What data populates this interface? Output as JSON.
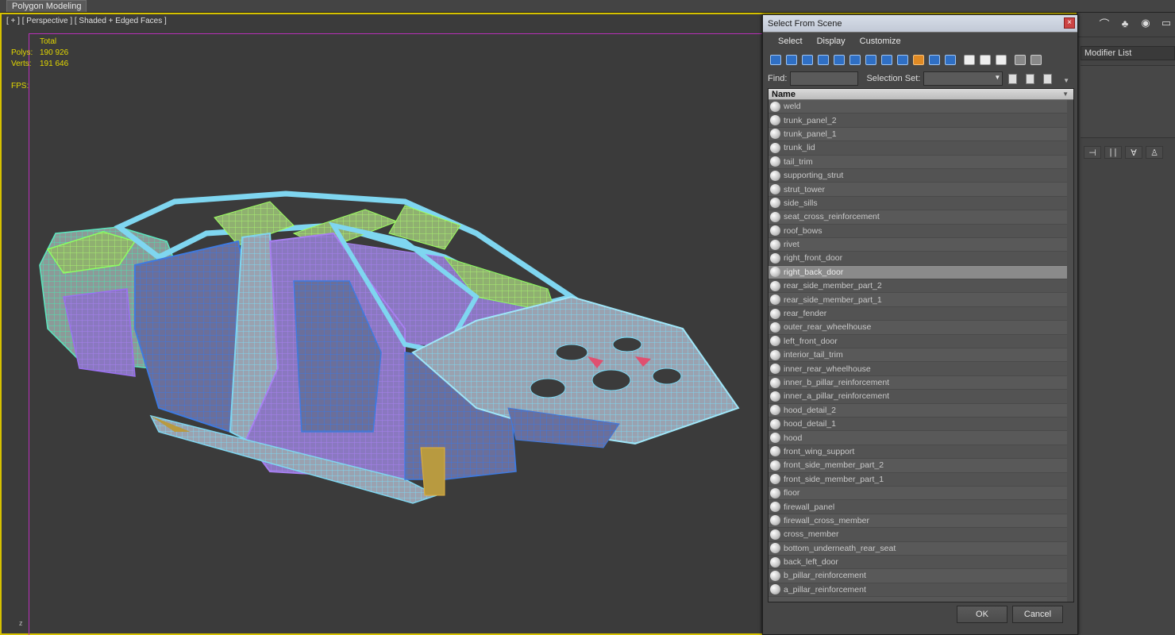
{
  "ribbon": {
    "active_tab": "Polygon Modeling"
  },
  "viewport": {
    "label": "[ + ] [ Perspective ] [ Shaded + Edged Faces ]",
    "stats": {
      "header": "Total",
      "polys_label": "Polys:",
      "polys_value": "190 926",
      "verts_label": "Verts:",
      "verts_value": "191 646",
      "fps_label": "FPS:"
    },
    "axis_label": "z"
  },
  "command_panel": {
    "modifier_list": "Modifier List"
  },
  "dialog": {
    "title": "Select From Scene",
    "close_glyph": "×",
    "menu": [
      "Select",
      "Display",
      "Customize"
    ],
    "find_label": "Find:",
    "find_value": "",
    "selection_set_label": "Selection Set:",
    "column_header": "Name",
    "selected_item": "right_back_door",
    "items": [
      "weld",
      "trunk_panel_2",
      "trunk_panel_1",
      "trunk_lid",
      "tail_trim",
      "supporting_strut",
      "strut_tower",
      "side_sills",
      "seat_cross_reinforcement",
      "roof_bows",
      "rivet",
      "right_front_door",
      "right_back_door",
      "rear_side_member_part_2",
      "rear_side_member_part_1",
      "rear_fender",
      "outer_rear_wheelhouse",
      "left_front_door",
      "interior_tail_trim",
      "inner_rear_wheelhouse",
      "inner_b_pillar_reinforcement",
      "inner_a_pillar_reinforcement",
      "hood_detail_2",
      "hood_detail_1",
      "hood",
      "front_wing_support",
      "front_side_member_part_2",
      "front_side_member_part_1",
      "floor",
      "firewall_panel",
      "firewall_cross_member",
      "cross_member",
      "bottom_underneath_rear_seat",
      "back_left_door",
      "b_pillar_reinforcement",
      "a_pillar_reinforcement"
    ],
    "ok_label": "OK",
    "cancel_label": "Cancel"
  }
}
